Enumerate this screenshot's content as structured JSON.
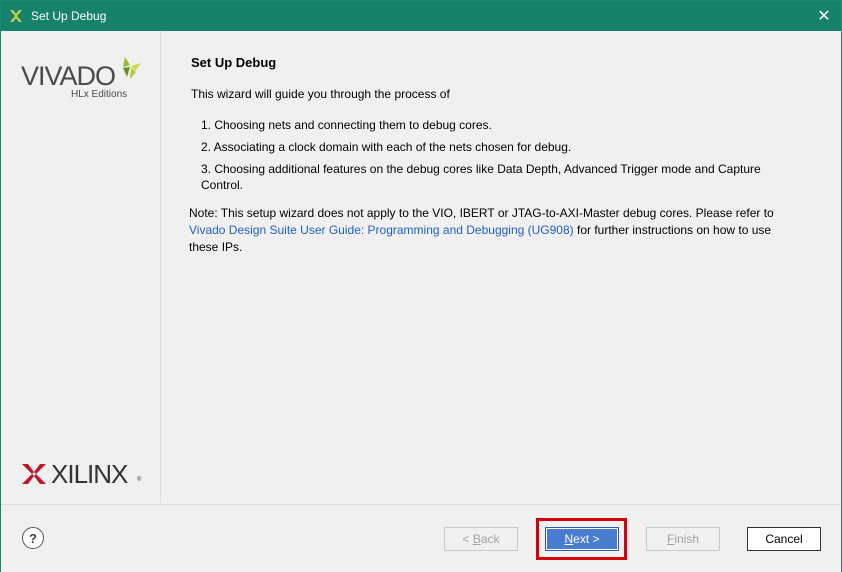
{
  "window": {
    "title": "Set Up Debug",
    "close_glyph": "✕"
  },
  "sidebar": {
    "vivado_text": "VIVADO",
    "vivado_sub": "HLx Editions",
    "xilinx_text": "XILINX",
    "xilinx_reg": "®"
  },
  "content": {
    "heading": "Set Up Debug",
    "intro": "This wizard will guide you through the process of",
    "steps": [
      "1.  Choosing nets and connecting them to debug cores.",
      "2.  Associating a clock domain with each of the nets chosen for debug.",
      "3.  Choosing additional features on the debug cores like Data Depth, Advanced Trigger mode and Capture Control."
    ],
    "note_prefix": "Note: This setup wizard does not apply to the VIO, IBERT or JTAG-to-AXI-Master debug cores. Please refer to",
    "note_link": "Vivado Design Suite User Guide: Programming and Debugging (UG908)",
    "note_suffix": "for further instructions on how to use these IPs."
  },
  "footer": {
    "help_glyph": "?",
    "back_label_prefix": "< ",
    "back_label_accel": "B",
    "back_label_rest": "ack",
    "next_label_accel": "N",
    "next_label_rest": "ext >",
    "finish_label_accel": "F",
    "finish_label_rest": "inish",
    "cancel_label": "Cancel"
  },
  "colors": {
    "titlebar": "#17826a",
    "link": "#1f5fbf",
    "next_button": "#4a7cd1",
    "highlight": "#d6000c"
  }
}
